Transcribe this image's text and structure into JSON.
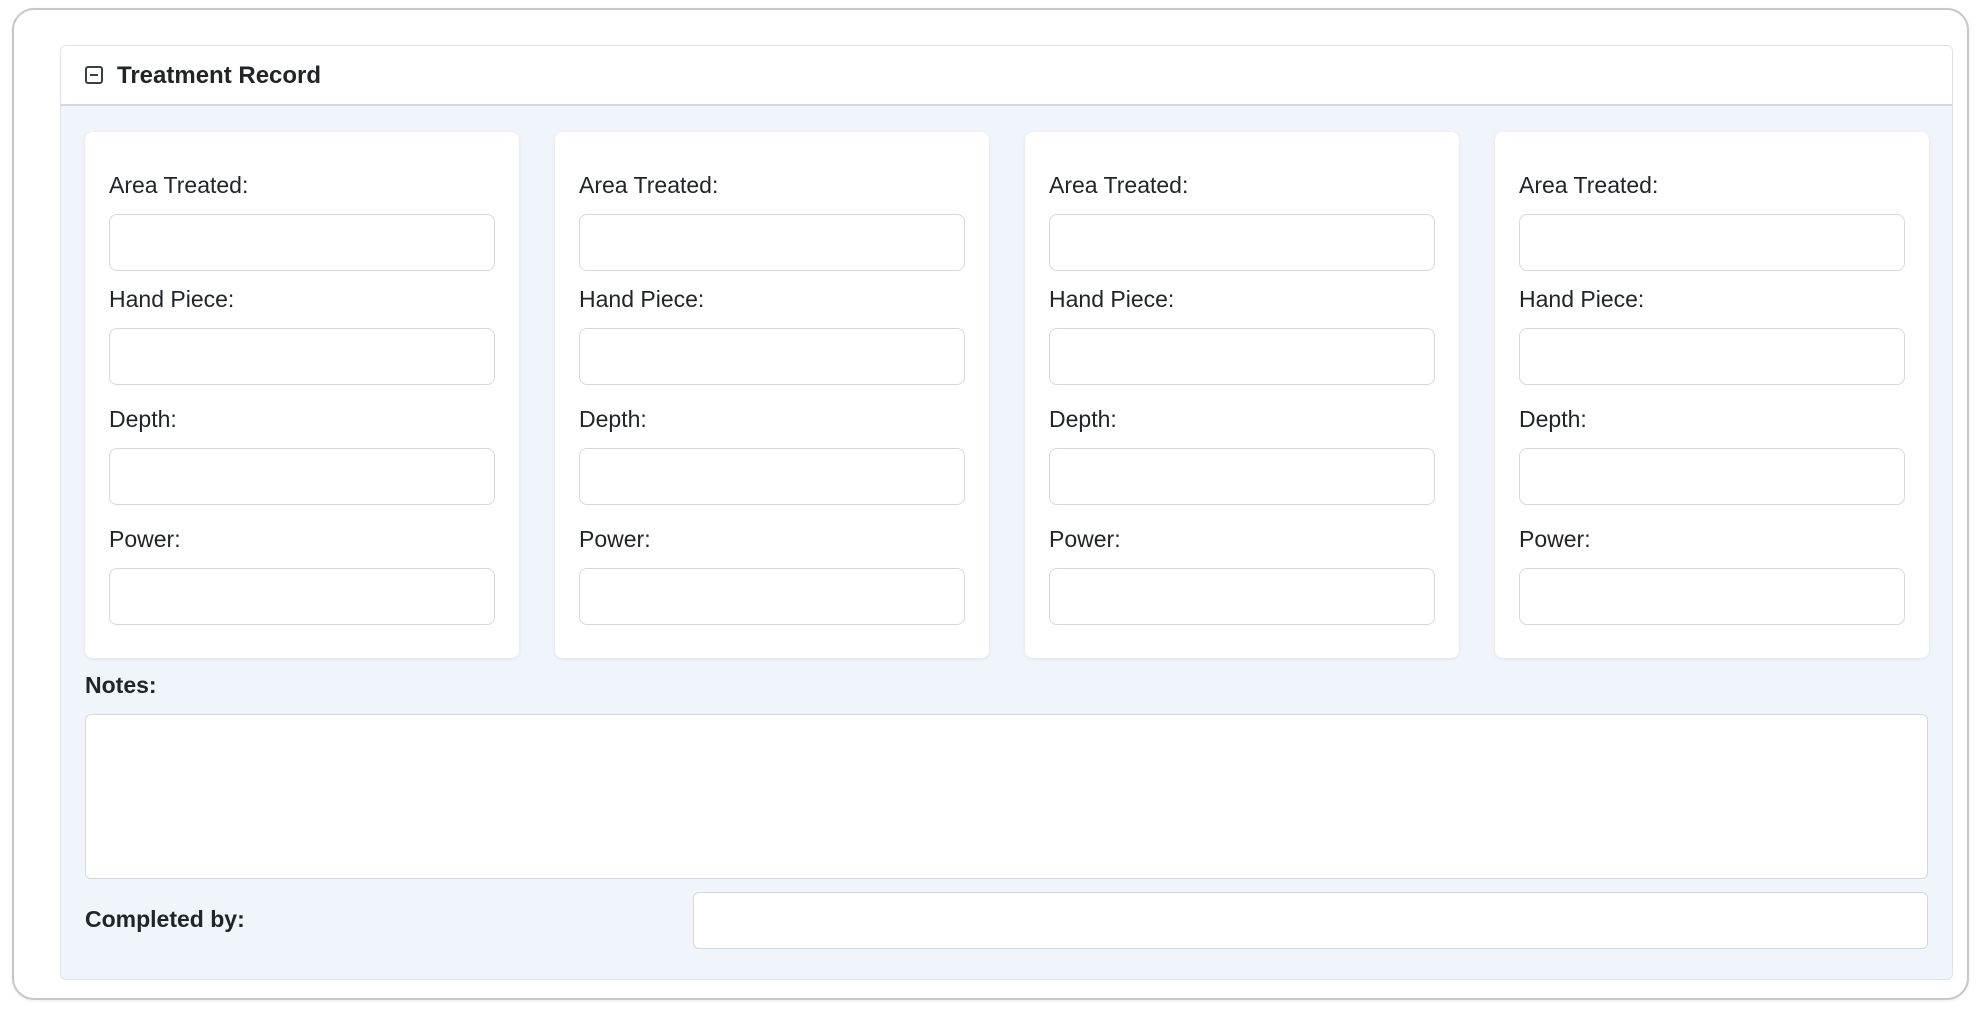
{
  "panel": {
    "title": "Treatment Record",
    "collapse_icon": "minus-square-icon"
  },
  "cards": [
    {
      "area_treated_label": "Area Treated:",
      "area_treated_value": "",
      "hand_piece_label": "Hand Piece:",
      "hand_piece_value": "",
      "depth_label": "Depth:",
      "depth_value": "",
      "power_label": "Power:",
      "power_value": ""
    },
    {
      "area_treated_label": "Area Treated:",
      "area_treated_value": "",
      "hand_piece_label": "Hand Piece:",
      "hand_piece_value": "",
      "depth_label": "Depth:",
      "depth_value": "",
      "power_label": "Power:",
      "power_value": ""
    },
    {
      "area_treated_label": "Area Treated:",
      "area_treated_value": "",
      "hand_piece_label": "Hand Piece:",
      "hand_piece_value": "",
      "depth_label": "Depth:",
      "depth_value": "",
      "power_label": "Power:",
      "power_value": ""
    },
    {
      "area_treated_label": "Area Treated:",
      "area_treated_value": "",
      "hand_piece_label": "Hand Piece:",
      "hand_piece_value": "",
      "depth_label": "Depth:",
      "depth_value": "",
      "power_label": "Power:",
      "power_value": ""
    }
  ],
  "notes": {
    "label": "Notes:",
    "value": ""
  },
  "completed_by": {
    "label": "Completed by:",
    "value": ""
  },
  "colors": {
    "panel_background": "#f0f5fb",
    "card_background": "#ffffff",
    "input_border": "#d4d9df",
    "text": "#212529"
  }
}
